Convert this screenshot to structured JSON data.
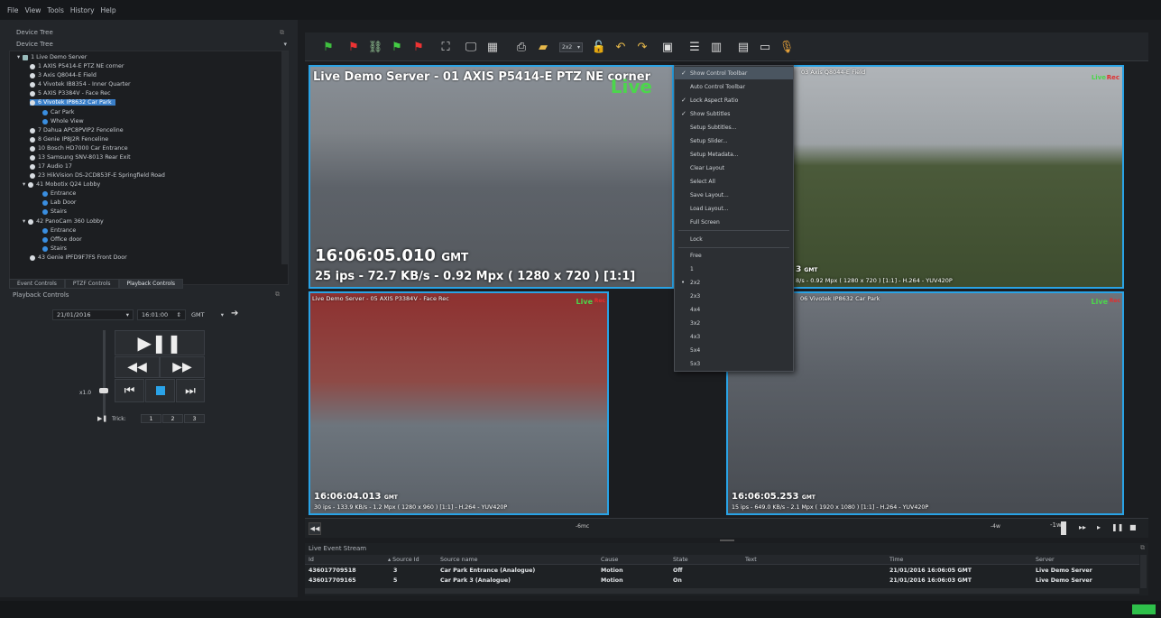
{
  "menu": [
    "File",
    "View",
    "Tools",
    "History",
    "Help"
  ],
  "device_tree": {
    "panel_title": "Device Tree",
    "dropdown": "Device Tree",
    "items": [
      "1 Live Demo Server",
      "1 AXIS P5414-E PTZ NE corner",
      "3 Axis Q8044-E Field",
      "4 Vivotek IB8354 - Inner Quarter",
      "5 AXIS P3384V - Face Rec",
      "6 Vivotek IP8632 Car Park",
      "Car Park",
      "Whole View",
      "7 Dahua APC8PVIP2 Fenceline",
      "8 Genie IP8J2R Fenceline",
      "10 Bosch HD7000 Car Entrance",
      "13 Samsung SNV-8013 Rear Exit",
      "17 Audio 17",
      "23 HikVision DS-2CD853F-E Springfield Road",
      "41 Mobotix Q24 Lobby",
      "Entrance",
      "Lab Door",
      "Stairs",
      "42 PanoCam 360 Lobby",
      "Entrance",
      "Office door",
      "Stairs",
      "43 Genie IPFD9F7FS Front Door"
    ]
  },
  "tabs": [
    "Event Controls",
    "PTZF Controls",
    "Playback Controls"
  ],
  "playback": {
    "title": "Playback Controls",
    "date": "21/01/2016",
    "time": "16:01:00",
    "tz": "GMT",
    "speed_label": "x1.0",
    "trick_label": "Trick:",
    "trick_values": [
      "1",
      "2",
      "3"
    ]
  },
  "toolbar": {
    "layout_select": "2x2"
  },
  "tiles": [
    {
      "header": "Live Demo Server - 01 AXIS P5414-E PTZ NE corner",
      "live": "Live",
      "time": "16:06:05.010",
      "tz": "GMT",
      "info": "25 ips  -  72.7 KB/s  -  0.92 Mpx  ( 1280 x 720 ) [1:1]"
    },
    {
      "header": "03 Axis Q8044-E Field",
      "live": "Live",
      "rec": "Rec",
      "time": "3",
      "tz": "GMT",
      "info": "8/s  -  0.92 Mpx  ( 1280 x 720 ) [1:1] - H.264  -  YUV420P"
    },
    {
      "header": "Live Demo Server - 05 AXIS P3384V - Face Rec",
      "live": "Live",
      "rec": "Rec",
      "time": "16:06:04.013",
      "tz": "GMT",
      "info": "30 ips  -  133.9 KB/s  -  1.2 Mpx  ( 1280 x 960 ) [1:1] - H.264  -  YUV420P"
    },
    {
      "header": "06 Vivotek IP8632 Car Park",
      "live": "Live",
      "rec": "Rec",
      "time": "16:06:05.253",
      "tz": "GMT",
      "info": "15 ips  -  649.0 KB/s  -  2.1 Mpx  ( 1920 x 1080 ) [1:1] - H.264  -  YUV420P"
    }
  ],
  "context_menu": [
    {
      "label": "Show Control Toolbar",
      "check": "✓"
    },
    {
      "label": "Auto Control Toolbar",
      "check": ""
    },
    {
      "label": "Lock Aspect Ratio",
      "check": "✓"
    },
    {
      "label": "Show Subtitles",
      "check": "✓"
    },
    {
      "label": "Setup Subtitles...",
      "check": ""
    },
    {
      "label": "Setup Slider...",
      "check": ""
    },
    {
      "label": "Setup Metadata...",
      "check": ""
    },
    {
      "label": "Clear Layout",
      "check": ""
    },
    {
      "label": "Select All",
      "check": ""
    },
    {
      "label": "Save Layout...",
      "check": ""
    },
    {
      "label": "Load Layout...",
      "check": ""
    },
    {
      "label": "Full Screen",
      "check": ""
    },
    {
      "label": "Lock",
      "check": ""
    },
    {
      "label": "Free",
      "check": ""
    },
    {
      "label": "1",
      "check": ""
    },
    {
      "label": "2x2",
      "check": "•"
    },
    {
      "label": "2x3",
      "check": ""
    },
    {
      "label": "4x4",
      "check": ""
    },
    {
      "label": "3x2",
      "check": ""
    },
    {
      "label": "4x3",
      "check": ""
    },
    {
      "label": "5x4",
      "check": ""
    },
    {
      "label": "5x3",
      "check": ""
    }
  ],
  "timeline": {
    "label_left": "-6mc",
    "label_mid": "-4w",
    "label_right": "-1w"
  },
  "event_stream": {
    "title": "Live Event Stream",
    "columns": [
      "Id",
      "Source Id",
      "Source name",
      "Cause",
      "State",
      "Text",
      "Time",
      "Server"
    ],
    "rows": [
      [
        "436017709518",
        "3",
        "Car Park Entrance (Analogue)",
        "Motion",
        "Off",
        "",
        "21/01/2016 16:06:05 GMT",
        "Live Demo Server"
      ],
      [
        "436017709165",
        "5",
        "Car Park 3 (Analogue)",
        "Motion",
        "On",
        "",
        "21/01/2016 16:06:03 GMT",
        "Live Demo Server"
      ]
    ]
  },
  "colors": {
    "accent": "#29a3e6",
    "live": "#4cd64c",
    "rec": "#e03030",
    "selection": "#3a7fc9"
  }
}
